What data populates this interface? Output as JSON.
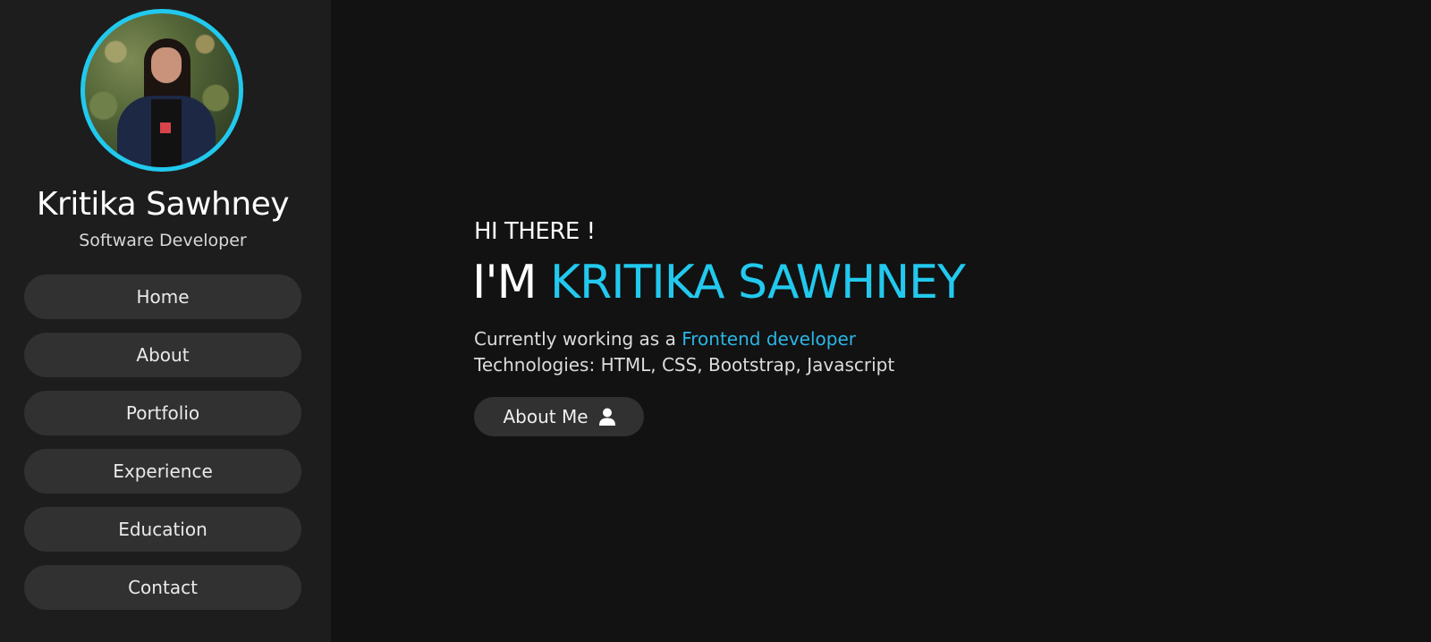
{
  "profile": {
    "name": "Kritika Sawhney",
    "role": "Software Developer"
  },
  "nav": {
    "items": [
      {
        "label": "Home"
      },
      {
        "label": "About"
      },
      {
        "label": "Portfolio"
      },
      {
        "label": "Experience"
      },
      {
        "label": "Education"
      },
      {
        "label": "Contact"
      }
    ]
  },
  "hero": {
    "greeting": "HI THERE !",
    "headline_prefix": "I'M",
    "headline_name": "KRITIKA SAWHNEY",
    "line1_prefix": "Currently working as a",
    "line1_highlight": "Frontend developer",
    "line2": "Technologies: HTML, CSS, Bootstrap, Javascript",
    "button_label": "About Me",
    "button_icon": "user-icon"
  },
  "colors": {
    "accent": "#22c9ee",
    "background": "#121212",
    "sidebar": "#1d1d1d",
    "button": "#313131"
  }
}
